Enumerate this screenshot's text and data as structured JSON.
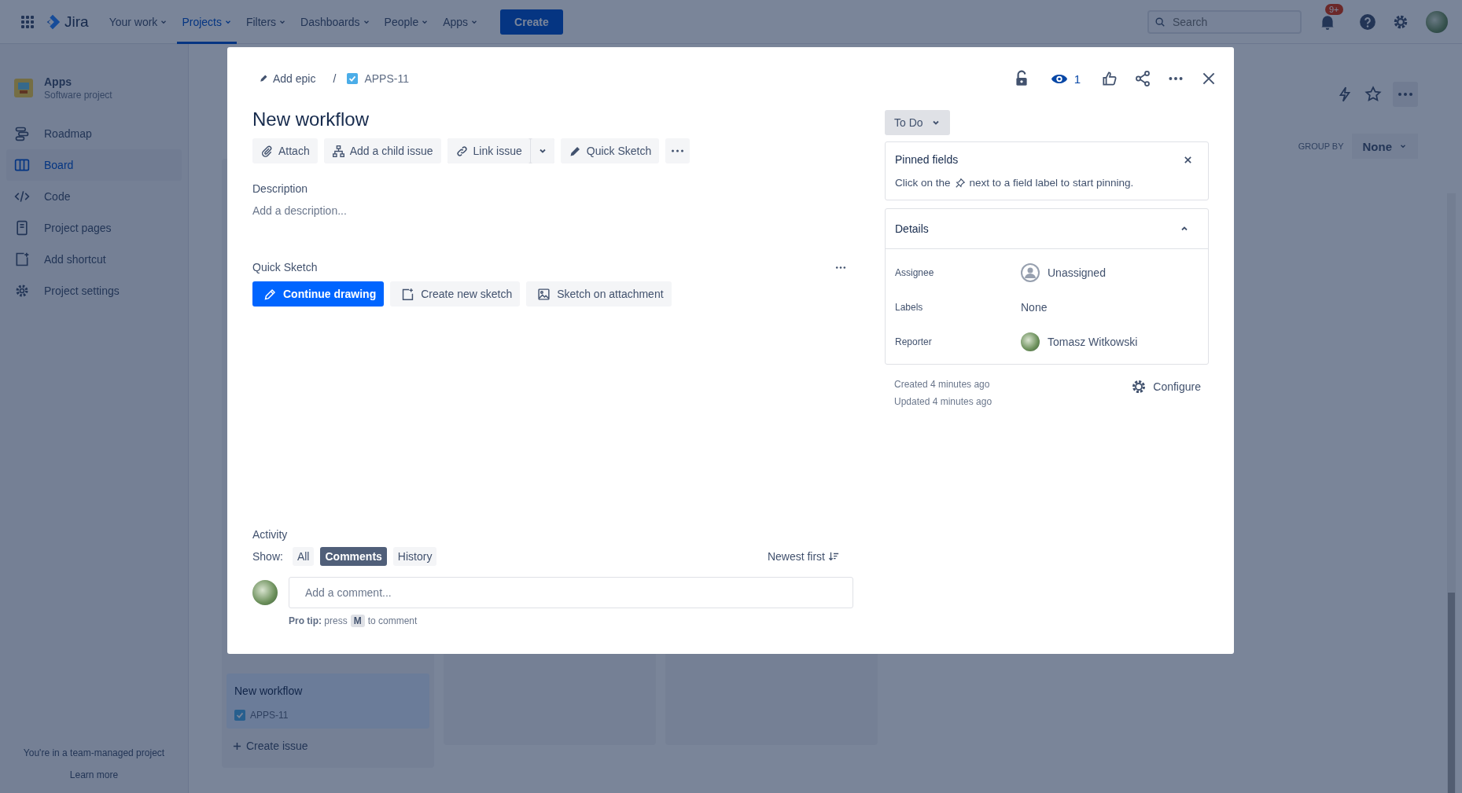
{
  "nav": {
    "brand": "Jira",
    "items": [
      {
        "label": "Your work",
        "selected": false
      },
      {
        "label": "Projects",
        "selected": true
      },
      {
        "label": "Filters",
        "selected": false
      },
      {
        "label": "Dashboards",
        "selected": false
      },
      {
        "label": "People",
        "selected": false
      },
      {
        "label": "Apps",
        "selected": false
      }
    ],
    "create": "Create",
    "search": {
      "placeholder": "Search"
    },
    "notifications": "9+"
  },
  "sidebar": {
    "project": {
      "name": "Apps",
      "type": "Software project"
    },
    "items": [
      {
        "label": "Roadmap",
        "kind": "roadmap",
        "selected": false
      },
      {
        "label": "Board",
        "kind": "board",
        "selected": true
      },
      {
        "label": "Code",
        "kind": "code",
        "selected": false
      },
      {
        "label": "Project pages",
        "kind": "pages",
        "selected": false
      },
      {
        "label": "Add shortcut",
        "kind": "shortcut",
        "selected": false
      },
      {
        "label": "Project settings",
        "kind": "settings",
        "selected": false
      }
    ],
    "footer": "You're in a team-managed project",
    "learn_more": "Learn more"
  },
  "board": {
    "group_by": {
      "label": "GROUP BY",
      "value": "None"
    },
    "card": {
      "title": "New workflow",
      "key": "APPS-11"
    },
    "create_issue": "Create issue"
  },
  "issue": {
    "breadcrumb": {
      "epic": "Add epic",
      "separator": "/",
      "key": "APPS-11"
    },
    "watchers": "1",
    "title": "New workflow",
    "toolbar": [
      {
        "label": "Attach",
        "kind": "attach"
      },
      {
        "label": "Add a child issue",
        "kind": "child"
      },
      {
        "label": "Link issue",
        "kind": "link"
      },
      {
        "label": "Quick Sketch",
        "kind": "sketch"
      },
      {
        "kind": "more"
      }
    ],
    "description": {
      "label": "Description",
      "placeholder": "Add a description..."
    },
    "quick_sketch": {
      "label": "Quick Sketch",
      "buttons": [
        {
          "label": "Continue drawing",
          "kind": "pencil",
          "primary": true
        },
        {
          "label": "Create new sketch",
          "kind": "new",
          "primary": false
        },
        {
          "label": "Sketch on attachment",
          "kind": "image",
          "primary": false
        }
      ]
    },
    "activity": {
      "label": "Activity",
      "show_label": "Show:",
      "filters": [
        {
          "label": "All",
          "selected": false
        },
        {
          "label": "Comments",
          "selected": true
        },
        {
          "label": "History",
          "selected": false
        }
      ],
      "sort": "Newest first",
      "comment": {
        "placeholder": "Add a comment..."
      },
      "tip": {
        "lead": "**Pro tip:** press",
        "key": "M",
        "tail": "to comment"
      }
    },
    "status": "To Do",
    "pinned": {
      "title": "Pinned fields",
      "before": "Click on the",
      "after": "next to a field label to start pinning."
    },
    "details": {
      "title": "Details",
      "expanded": true,
      "fields": [
        {
          "label": "Assignee",
          "value": "Unassigned",
          "kind": "person"
        },
        {
          "label": "Labels",
          "value": "None",
          "kind": "text"
        },
        {
          "label": "Reporter",
          "value": "Tomasz Witkowski",
          "kind": "user"
        }
      ]
    },
    "created": "Created 4 minutes ago",
    "updated": "Updated 4 minutes ago",
    "configure": "Configure"
  }
}
